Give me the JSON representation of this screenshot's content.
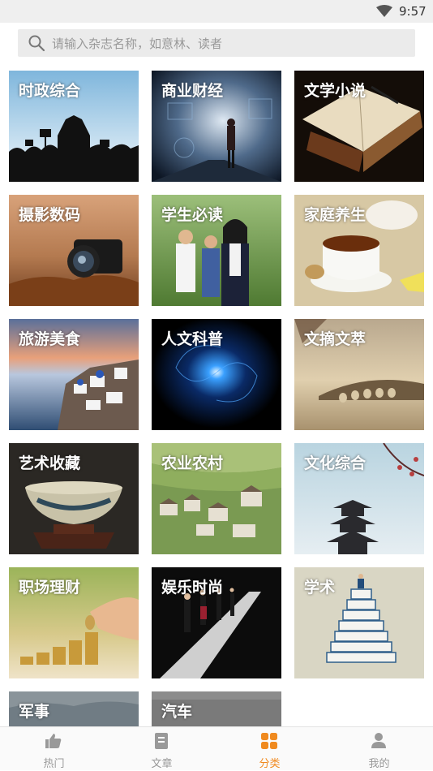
{
  "status_bar": {
    "time": "9:57"
  },
  "search": {
    "placeholder": "请输入杂志名称，如意林、读者"
  },
  "categories": [
    "时政综合",
    "商业财经",
    "文学小说",
    "摄影数码",
    "学生必读",
    "家庭养生",
    "旅游美食",
    "人文科普",
    "文摘文萃",
    "艺术收藏",
    "农业农村",
    "文化综合",
    "职场理财",
    "娱乐时尚",
    "学术",
    "军事",
    "汽车"
  ],
  "tabbar": {
    "tabs": [
      "热门",
      "文章",
      "分类",
      "我的"
    ],
    "active": "分类"
  },
  "colors": {
    "accent": "#f08a1f",
    "inactive": "#999999"
  }
}
